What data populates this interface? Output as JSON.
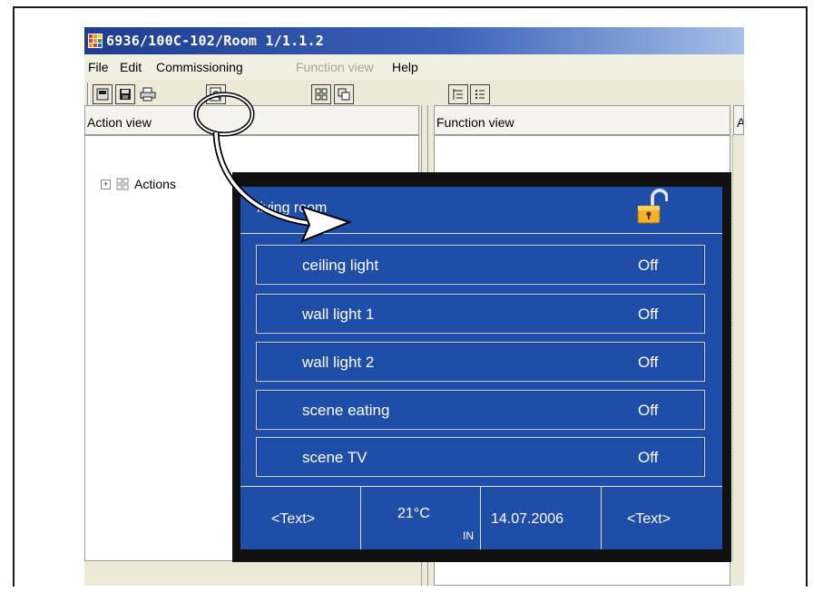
{
  "window": {
    "title": "6936/100C-102/Room 1/1.1.2",
    "colors": {
      "titlebar": "#1e3d8f",
      "panel_bg": "#1f4ea8",
      "panel_frame": "#111111"
    }
  },
  "menu": {
    "items": [
      {
        "label": "File",
        "enabled": true
      },
      {
        "label": "Edit",
        "enabled": true
      },
      {
        "label": "Commissioning",
        "enabled": true
      },
      {
        "label": "Function view",
        "enabled": false
      },
      {
        "label": "Help",
        "enabled": true
      }
    ]
  },
  "toolbar": {
    "icons": [
      "new-icon",
      "save-icon",
      "print-icon",
      "preview-icon",
      "grid-view-icon",
      "window-view-icon",
      "tree-view-icon",
      "list-view-icon"
    ]
  },
  "panels": {
    "action_view": "Action view",
    "function_view": "Function view",
    "third_view_partial": "A"
  },
  "tree": {
    "root_label": "Actions"
  },
  "room_panel": {
    "title": "living room",
    "rows": [
      {
        "label": "ceiling light",
        "value": "Off"
      },
      {
        "label": "wall light 1",
        "value": "Off"
      },
      {
        "label": "wall light 2",
        "value": "Off"
      },
      {
        "label": "scene eating",
        "value": "Off"
      },
      {
        "label": "scene TV",
        "value": "Off"
      }
    ],
    "footer": {
      "left_text": "<Text>",
      "temperature": "21°C",
      "temperature_sub": "IN",
      "date": "14.07.2006",
      "right_text": "<Text>"
    }
  }
}
